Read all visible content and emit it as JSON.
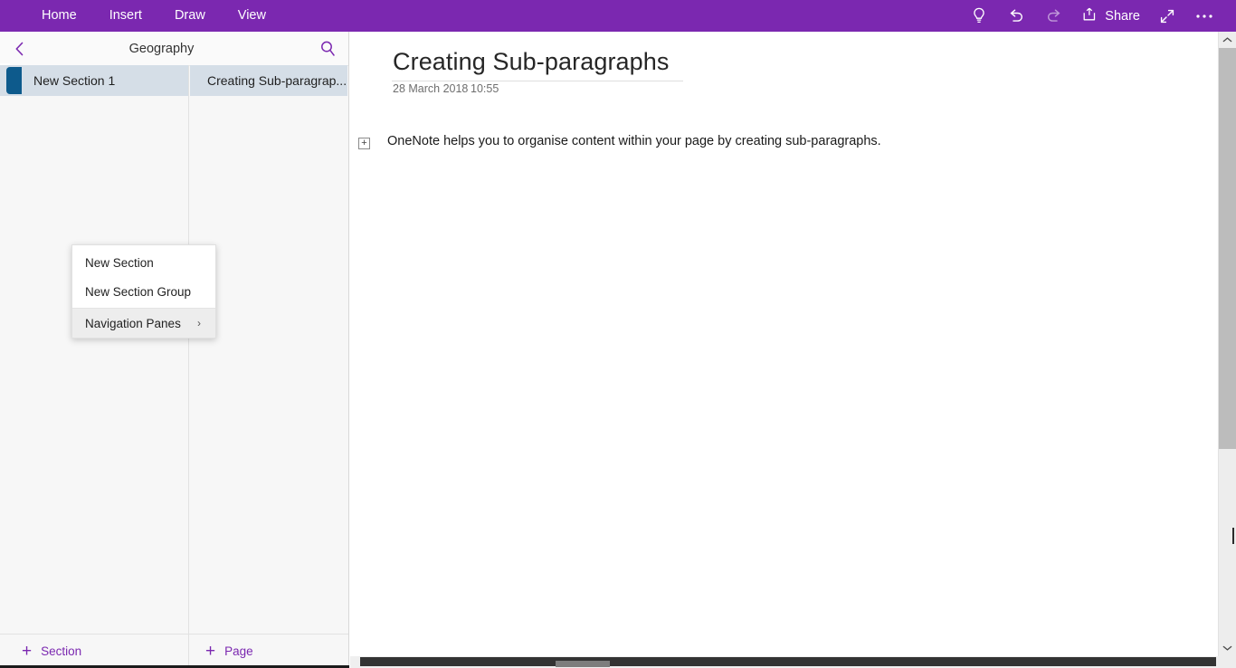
{
  "app": {
    "name": "OneNote",
    "accent_color": "#7B28B0",
    "selection_color": "#D5DEE7",
    "section_tab_color": "#0D5A8C"
  },
  "ribbon": {
    "tabs": [
      {
        "label": "Home",
        "active": true
      },
      {
        "label": "Insert",
        "active": false
      },
      {
        "label": "Draw",
        "active": false
      },
      {
        "label": "View",
        "active": false
      }
    ],
    "actions": [
      {
        "name": "tell-me-icon",
        "label": "Tell me what you want to do"
      },
      {
        "name": "undo-icon",
        "label": "Undo"
      },
      {
        "name": "redo-icon",
        "label": "Redo"
      }
    ],
    "share_label": "Share",
    "fullscreen_label": "Full screen",
    "more_label": "More options"
  },
  "navigation": {
    "back_label": "Back",
    "notebook_title": "Geography",
    "search_label": "Search",
    "sections": [
      {
        "label": "New Section 1",
        "selected": true
      }
    ],
    "pages": [
      {
        "label": "Creating Sub-paragrap...",
        "selected": true
      }
    ],
    "add_section_label": "Section",
    "add_page_label": "Page",
    "plus_glyph": "+"
  },
  "context_menu": {
    "items": [
      {
        "label": "New Section",
        "hovered": false,
        "submenu": false
      },
      {
        "label": "New Section Group",
        "hovered": false,
        "submenu": false
      },
      {
        "label": "Navigation Panes",
        "hovered": true,
        "submenu": true
      }
    ],
    "chevron_glyph": "›"
  },
  "page": {
    "title": "Creating Sub-paragraphs",
    "date": "28 March 2018",
    "time": "10:55",
    "expand_glyph": "+",
    "body_text": "OneNote helps you to organise content within your page by creating sub-paragraphs."
  },
  "scrollbars": {
    "vertical_up_label": "Scroll up",
    "vertical_down_label": "Scroll down",
    "horizontal_label": "Horizontal scrollbar"
  }
}
